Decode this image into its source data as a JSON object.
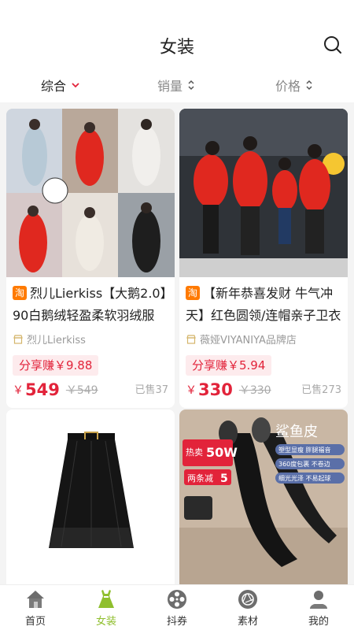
{
  "header": {
    "title": "女装"
  },
  "sort": [
    {
      "label": "综合",
      "active": true
    },
    {
      "label": "销量",
      "active": false
    },
    {
      "label": "价格",
      "active": false
    }
  ],
  "products": [
    {
      "badge": "淘",
      "title": "烈儿Lierkiss【大鹅2.0】90白鹅绒轻盈柔软羽绒服",
      "shop": "烈儿Lierkiss",
      "share": "分享赚￥9.88",
      "currency": "￥",
      "price": "549",
      "original": "￥549",
      "sold": "已售37"
    },
    {
      "badge": "淘",
      "title": "【新年恭喜发财 牛气冲天】红色圆领/连帽亲子卫衣",
      "shop": "薇娅VIYANIYA品牌店",
      "share": "分享赚￥5.94",
      "currency": "￥",
      "price": "330",
      "original": "￥330",
      "sold": "已售273"
    },
    {
      "image_texts": []
    },
    {
      "image_texts": [
        "鲨鱼皮",
        "热卖",
        "50W",
        "塑型显瘦 胖腿福音",
        "360度包裹 不卷边",
        "细光光泽 不易起球",
        "两条减",
        "5"
      ]
    }
  ],
  "tabs": [
    {
      "label": "首页",
      "icon": "home-icon",
      "active": false
    },
    {
      "label": "女装",
      "icon": "dress-icon",
      "active": true
    },
    {
      "label": "抖券",
      "icon": "film-reel-icon",
      "active": false
    },
    {
      "label": "素材",
      "icon": "aperture-icon",
      "active": false
    },
    {
      "label": "我的",
      "icon": "user-icon",
      "active": false
    }
  ],
  "colors": {
    "accent": "#e2233a",
    "tab_active": "#8fbf2e",
    "badge": "#ff7a00"
  }
}
